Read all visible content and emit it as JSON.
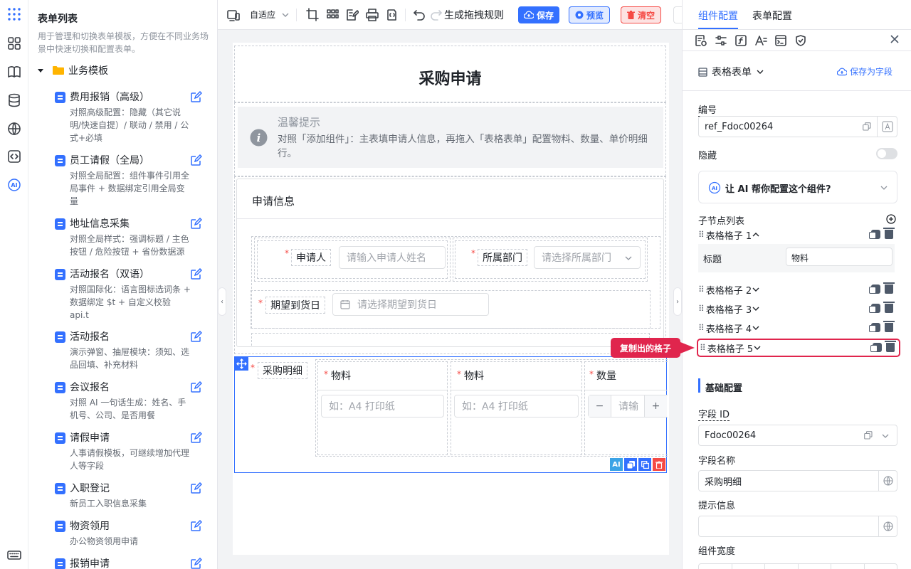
{
  "rail": {
    "icons": [
      "apps-icon",
      "grid-icon",
      "book-icon",
      "database-icon",
      "globe-icon",
      "code-icon",
      "ai-icon",
      "keyboard-icon"
    ]
  },
  "left_panel": {
    "title": "表单列表",
    "description": "用于管理和切换表单模板，方便在不同业务场景中快速切换和配置表单。",
    "folder": "业务模板",
    "templates": [
      {
        "name": "费用报销（高级）",
        "desc": "对照高级配置：隐藏（其它说明/快速自提）/ 联动 / 禁用 / 公式+必填"
      },
      {
        "name": "员工请假（全局）",
        "desc": "对照全局配置：组件事件引用全局事件 + 数据绑定引用全局变量"
      },
      {
        "name": "地址信息采集",
        "desc": "对照全局样式：强调标题 / 主色按钮 / 危险按钮 + 省份数据源"
      },
      {
        "name": "活动报名（双语）",
        "desc": "对照国际化：语言图标选词条 + 数据绑定 $t + 自定义校验 api.t"
      },
      {
        "name": "活动报名",
        "desc": "演示弹窗、抽屉模块：须知、选品回填、补充材料"
      },
      {
        "name": "会议报名",
        "desc": "对照 AI 一句话生成：姓名、手机号、公司、是否用餐"
      },
      {
        "name": "请假申请",
        "desc": "人事请假模板，可继续增加代理人等字段"
      },
      {
        "name": "入职登记",
        "desc": "新员工入职信息采集"
      },
      {
        "name": "物资领用",
        "desc": "办公物资领用申请"
      },
      {
        "name": "报销申请",
        "desc": ""
      }
    ]
  },
  "toolbar": {
    "adaptive": "自适应",
    "gen_rules": "生成拖拽规则",
    "save": "保存",
    "preview": "预览",
    "clear": "清空"
  },
  "form": {
    "title": "采购申请",
    "tip_title": "温馨提示",
    "tip_text": "对照「添加组件」：主表填申请人信息，再拖入「表格表单」配置物料、数量、单价明细行。",
    "section_title": "申请信息",
    "applicant_label": "申请人",
    "applicant_placeholder": "请输入申请人姓名",
    "dept_label": "所属部门",
    "dept_placeholder": "请选择所属部门",
    "date_label": "期望到货日",
    "date_placeholder": "请选择期望到货日",
    "table_label": "采购明细",
    "col1": "物料",
    "col2": "物料",
    "col3": "数量",
    "col1_placeholder": "如：A4 打印纸",
    "col2_placeholder": "如：A4 打印纸",
    "qty_placeholder": "请输",
    "minus": "−",
    "plus": "+",
    "ai_badge": "AI"
  },
  "right_panel": {
    "tab_component": "组件配置",
    "tab_form": "表单配置",
    "component_type": "表格表单",
    "save_as_field": "保存为字段",
    "code_label": "编号",
    "code_value": "ref_Fdoc00264",
    "hidden_label": "隐藏",
    "ai_prompt": "让 AI 帮你配置这个组件?",
    "children_label": "子节点列表",
    "children": [
      {
        "name": "表格格子 1"
      },
      {
        "name": "表格格子 2"
      },
      {
        "name": "表格格子 3"
      },
      {
        "name": "表格格子 4"
      },
      {
        "name": "表格格子 5"
      }
    ],
    "child_title_label": "标题",
    "child_title_value": "物料",
    "callout": "复制出的格子",
    "basic_config": "基础配置",
    "field_id_label": "字段 ID",
    "field_id_value": "Fdoc00264",
    "field_name_label": "字段名称",
    "field_name_value": "采购明细",
    "hint_label": "提示信息",
    "hint_value": "",
    "width_label": "组件宽度"
  },
  "colors": {
    "primary": "#3370ff",
    "danger": "#f54a45",
    "highlight": "#e0254d",
    "tip_bg": "#f2f3f5"
  }
}
